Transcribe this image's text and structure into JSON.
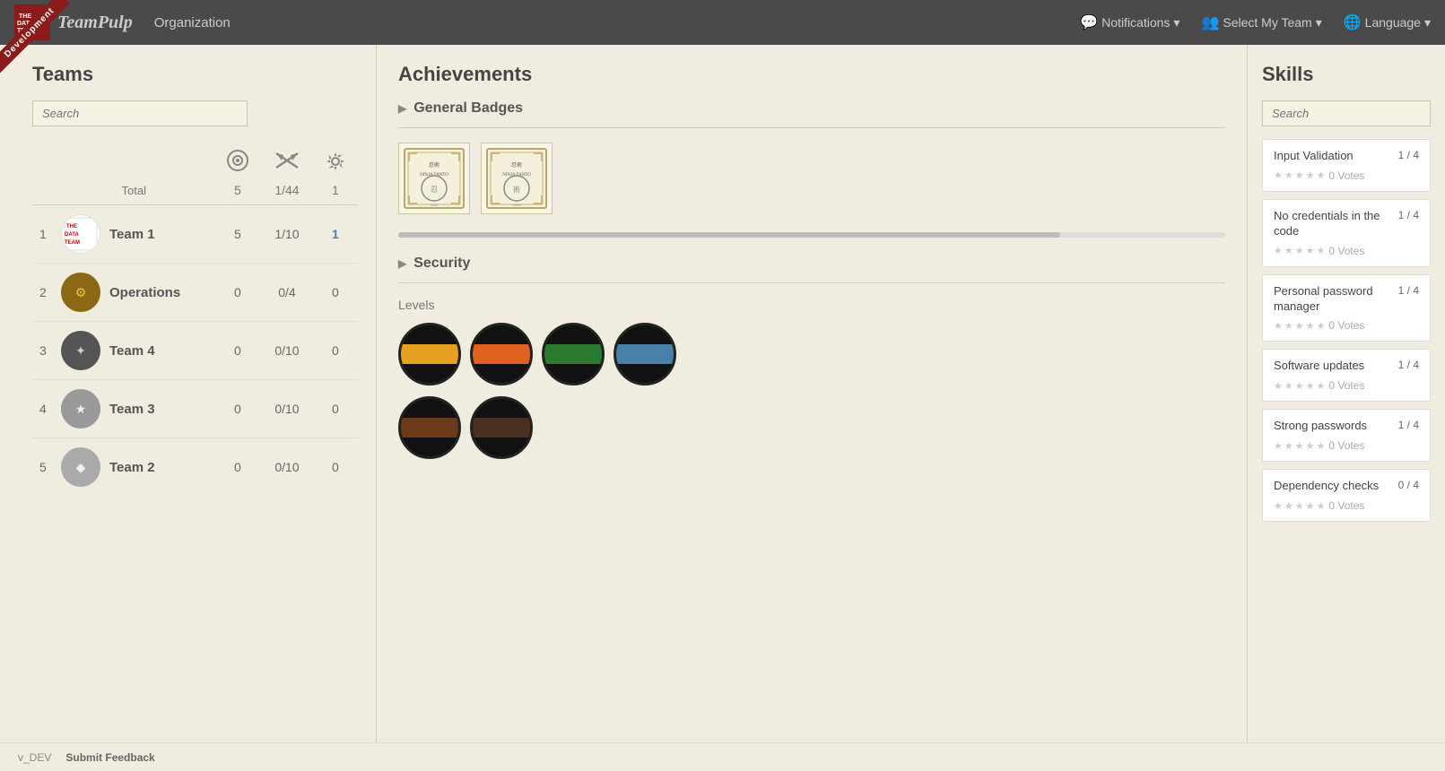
{
  "app": {
    "title": "TeamPulp",
    "env_ribbon": "Development",
    "org_label": "Organization"
  },
  "navbar": {
    "notifications_label": "Notifications",
    "select_team_label": "Select My Team",
    "language_label": "Language"
  },
  "teams_panel": {
    "title": "Teams",
    "search_placeholder": "Search",
    "columns": {
      "rank": "",
      "total_label": "Total",
      "col1_value": "5",
      "col2_value": "1/44",
      "col3_value": "1"
    },
    "rows": [
      {
        "rank": 1,
        "name": "Team 1",
        "c1": "5",
        "c2": "1/10",
        "c3": "1",
        "highlight_c3": true
      },
      {
        "rank": 2,
        "name": "Operations",
        "c1": "0",
        "c2": "0/4",
        "c3": "0",
        "highlight_c3": false
      },
      {
        "rank": 3,
        "name": "Team 4",
        "c1": "0",
        "c2": "0/10",
        "c3": "0",
        "highlight_c3": false
      },
      {
        "rank": 4,
        "name": "Team 3",
        "c1": "0",
        "c2": "0/10",
        "c3": "0",
        "highlight_c3": false
      },
      {
        "rank": 5,
        "name": "Team 2",
        "c1": "0",
        "c2": "0/10",
        "c3": "0",
        "highlight_c3": false
      }
    ]
  },
  "achievements_panel": {
    "title": "Achievements",
    "sections": [
      {
        "name": "General Badges",
        "id": "general-badges",
        "badge_count": 2
      },
      {
        "name": "Security",
        "id": "security"
      }
    ],
    "levels_label": "Levels",
    "levels": [
      {
        "color": "#e8a020",
        "id": "yellow-belt"
      },
      {
        "color": "#e06020",
        "id": "orange-belt"
      },
      {
        "color": "#2a7a30",
        "id": "green-belt"
      },
      {
        "color": "#4a80a8",
        "id": "blue-belt"
      },
      {
        "color": "#6b3a18",
        "id": "brown-belt1"
      },
      {
        "color": "#3a3a3a",
        "id": "brown-belt2"
      }
    ]
  },
  "skills_panel": {
    "title": "Skills",
    "search_placeholder": "Search",
    "items": [
      {
        "name": "Input Validation",
        "score": "1 / 4",
        "votes_label": "0 Votes",
        "stars": 0
      },
      {
        "name": "No credentials in the code",
        "score": "1 / 4",
        "votes_label": "0 Votes",
        "stars": 0
      },
      {
        "name": "Personal password manager",
        "score": "1 / 4",
        "votes_label": "0 Votes",
        "stars": 0
      },
      {
        "name": "Software updates",
        "score": "1 / 4",
        "votes_label": "0 Votes",
        "stars": 0
      },
      {
        "name": "Strong passwords",
        "score": "1 / 4",
        "votes_label": "0 Votes",
        "stars": 0
      },
      {
        "name": "Dependency checks",
        "score": "0 / 4",
        "votes_label": "0 Votes",
        "stars": 0
      }
    ]
  },
  "footer": {
    "version": "v_DEV",
    "feedback_label": "Submit Feedback"
  }
}
